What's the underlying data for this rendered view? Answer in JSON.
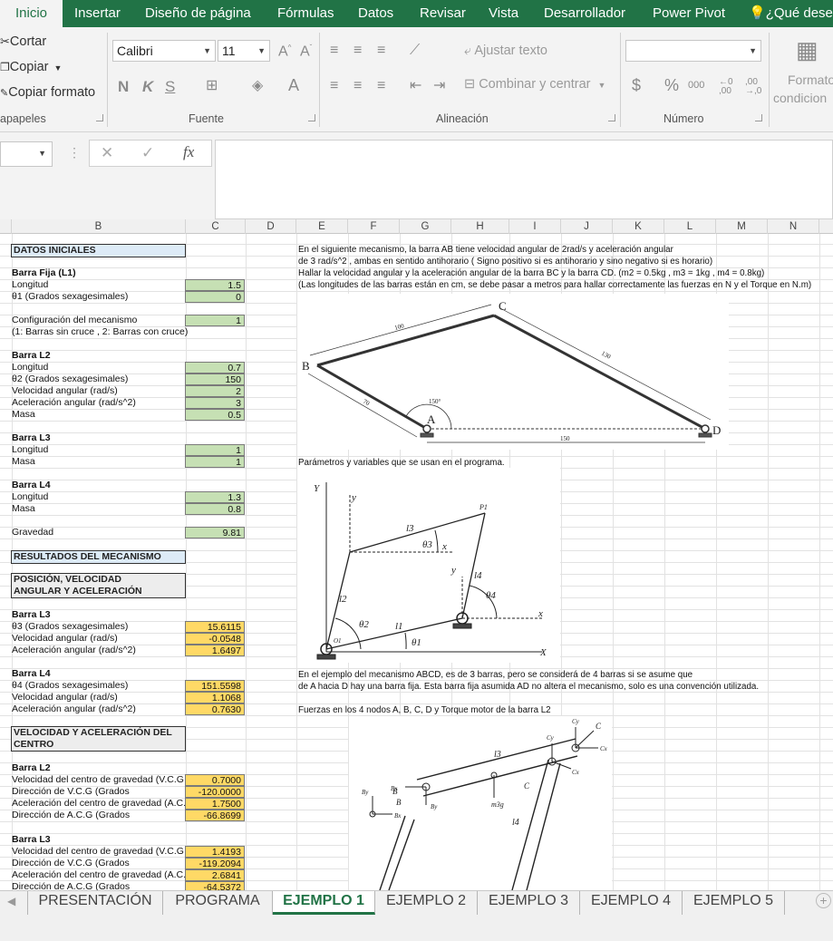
{
  "ribbon_tabs": [
    "Inicio",
    "Insertar",
    "Diseño de página",
    "Fórmulas",
    "Datos",
    "Revisar",
    "Vista",
    "Desarrollador",
    "Power Pivot",
    "¿Qué desea"
  ],
  "clipboard": {
    "cut": "Cortar",
    "copy": "Copiar",
    "format_painter": "Copiar formato",
    "group_label": "apapeles"
  },
  "font": {
    "name": "Calibri",
    "size": "11",
    "bold": "N",
    "italic": "K",
    "underline": "S",
    "group_label": "Fuente"
  },
  "alignment": {
    "wrap": "Ajustar texto",
    "merge": "Combinar y centrar",
    "group_label": "Alineación"
  },
  "number": {
    "currency": "$",
    "percent": "%",
    "thousands": "000",
    "group_label": "Número"
  },
  "styles": {
    "conditional_line1": "Formato",
    "conditional_line2": "condicion"
  },
  "formula_bar": {
    "fx": "fx"
  },
  "columns": [
    "B",
    "C",
    "D",
    "E",
    "F",
    "G",
    "H",
    "I",
    "J",
    "K",
    "L",
    "M",
    "N"
  ],
  "left": {
    "datos_iniciales": "DATOS INICIALES",
    "barra_fija": "Barra Fija (L1)",
    "l1_longitud": "Longitud",
    "l1_longitud_v": "1.5",
    "l1_theta": "θ1 (Grados sexagesimales)",
    "l1_theta_v": "0",
    "config": "Configuración del mecanismo",
    "config_v": "1",
    "config_note": "(1: Barras sin cruce , 2: Barras con cruce)",
    "barra_l2": "Barra L2",
    "l2_longitud": "Longitud",
    "l2_longitud_v": "0.7",
    "l2_theta": "θ2 (Grados sexagesimales)",
    "l2_theta_v": "150",
    "l2_vel": "Velocidad angular (rad/s)",
    "l2_vel_v": "2",
    "l2_acc": "Aceleración angular (rad/s^2)",
    "l2_acc_v": "3",
    "l2_masa": "Masa",
    "l2_masa_v": "0.5",
    "barra_l3": "Barra L3",
    "l3_longitud": "Longitud",
    "l3_longitud_v": "1",
    "l3_masa": "Masa",
    "l3_masa_v": "1",
    "barra_l4": "Barra L4",
    "l4_longitud": "Longitud",
    "l4_longitud_v": "1.3",
    "l4_masa": "Masa",
    "l4_masa_v": "0.8",
    "gravedad": "Gravedad",
    "gravedad_v": "9.81",
    "resultados": "RESULTADOS DEL MECANISMO",
    "pos_vel_line1": "POSICIÓN, VELOCIDAD",
    "pos_vel_line2": "ANGULAR Y ACELERACIÓN",
    "r_l3": "Barra L3",
    "r_l3_theta": "θ3 (Grados sexagesimales)",
    "r_l3_theta_v": "15.6115",
    "r_l3_vel": "Velocidad angular (rad/s)",
    "r_l3_vel_v": "-0.0548",
    "r_l3_acc": "Aceleración angular (rad/s^2)",
    "r_l3_acc_v": "1.6497",
    "r_l4": "Barra L4",
    "r_l4_theta": "θ4 (Grados sexagesimales)",
    "r_l4_theta_v": "151.5598",
    "r_l4_vel": "Velocidad angular (rad/s)",
    "r_l4_vel_v": "1.1068",
    "r_l4_acc": "Aceleración angular (rad/s^2)",
    "r_l4_acc_v": "0.7630",
    "vac_line1": "VELOCIDAD Y ACELERACIÓN DEL",
    "vac_line2": "CENTRO",
    "c_l2": "Barra L2",
    "c_l2_vcg": "Velocidad del centro de gravedad (V.C.G",
    "c_l2_vcg_v": "0.7000",
    "c_l2_dvcg": "Dirección de V.C.G (Grados",
    "c_l2_dvcg_v": "-120.0000",
    "c_l2_acg": "Aceleración del centro de gravedad (A.C.",
    "c_l2_acg_v": "1.7500",
    "c_l2_dacg": "Dirección de A.C.G (Grados",
    "c_l2_dacg_v": "-66.8699",
    "c_l3": "Barra L3",
    "c_l3_vcg": "Velocidad del centro de gravedad (V.C.G",
    "c_l3_vcg_v": "1.4193",
    "c_l3_dvcg": "Dirección de V.C.G (Grados",
    "c_l3_dvcg_v": "-119.2094",
    "c_l3_acg": "Aceleración del centro de gravedad (A.C.",
    "c_l3_acg_v": "2.6841",
    "c_l3_dacg": "Dirección de A.C.G (Grados",
    "c_l3_dacg_v": "-64.5372"
  },
  "right": {
    "p1": "En el siguiente mecanismo, la barra AB tiene velocidad angular de 2rad/s y aceleración angular",
    "p2": "de 3 rad/s^2 , ambas en sentido antihorario ( Signo positivo si es antihorario y sino negativo si es horario)",
    "p3": "Hallar la velocidad angular y la aceleración angular de la barra BC y la barra CD. (m2 = 0.5kg , m3 = 1kg , m4 = 0.8kg)",
    "p4": "(Las longitudes de las barras están en cm, se debe pasar a metros para hallar correctamente las fuerzas en N y el Torque en N.m)",
    "params": "Parámetros y variables que se usan en el programa.",
    "ej1": "En el ejemplo del mecanismo ABCD, es de 3 barras, pero se considerá de 4 barras si se asume que",
    "ej2": "de A hacia D hay una barra fija. Esta barra fija asumida AD no altera el mecanismo, solo es una convención utilizada.",
    "fuerzas": "Fuerzas en los 4 nodos A, B, C, D y Torque motor de la barra L2"
  },
  "diagram1": {
    "B": "B",
    "C": "C",
    "A": "A",
    "D": "D",
    "len_bc": "100",
    "len_cd": "130",
    "len_ab": "70",
    "len_ad": "150",
    "angle": "150°"
  },
  "diagram2": {
    "Y": "Y",
    "X": "X",
    "y": "y",
    "x": "x",
    "y2": "y",
    "x2": "x",
    "P1": "P1",
    "O1": "O1",
    "l1": "l1",
    "l2": "l2",
    "l3": "l3",
    "l4": "l4",
    "t1": "θ1",
    "t2": "θ2",
    "t3": "θ3",
    "t4": "θ4"
  },
  "diagram3": {
    "Cy": "Cy",
    "C": "C",
    "Cx": "Cx",
    "l3": "l3",
    "m3g": "m3g",
    "Bx": "Bx",
    "B": "B",
    "By": "By",
    "B2": "B",
    "By2": "By",
    "Bx2": "Bx",
    "C2": "C",
    "Cy2": "Cy",
    "Cx2": "Cx",
    "l4": "l4"
  },
  "sheet_tabs": [
    "PRESENTACIÓN",
    "PROGRAMA",
    "EJEMPLO 1",
    "EJEMPLO 2",
    "EJEMPLO 3",
    "EJEMPLO 4",
    "EJEMPLO 5"
  ],
  "active_sheet": "EJEMPLO 1",
  "colors": {
    "ribbon_green": "#217346",
    "input_green": "#c6e0b4",
    "result_orange": "#ffd966",
    "section_blue": "#ddebf7"
  }
}
